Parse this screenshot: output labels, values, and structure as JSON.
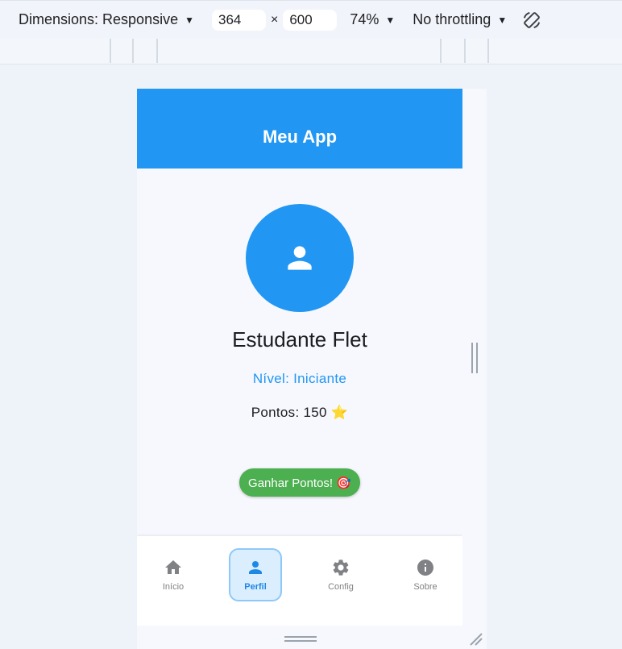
{
  "devtools": {
    "dimensions_label": "Dimensions: Responsive",
    "width": "364",
    "times": "×",
    "height": "600",
    "zoom": "74%",
    "throttling": "No throttling",
    "rotate_icon": "rotate-icon"
  },
  "app": {
    "title": "Meu App",
    "avatar_icon": "person-icon",
    "name": "Estudante Flet",
    "level": "Nível: Iniciante",
    "points": "Pontos: 150 ⭐",
    "gain_button": "Ganhar Pontos! 🎯",
    "colors": {
      "primary": "#2196f3",
      "button": "#4caf50"
    }
  },
  "bottom_nav": {
    "items": [
      {
        "label": "Início",
        "icon": "home-icon"
      },
      {
        "label": "Perfil",
        "icon": "person-icon",
        "active": true
      },
      {
        "label": "Config",
        "icon": "gear-icon"
      },
      {
        "label": "Sobre",
        "icon": "info-icon"
      }
    ]
  }
}
